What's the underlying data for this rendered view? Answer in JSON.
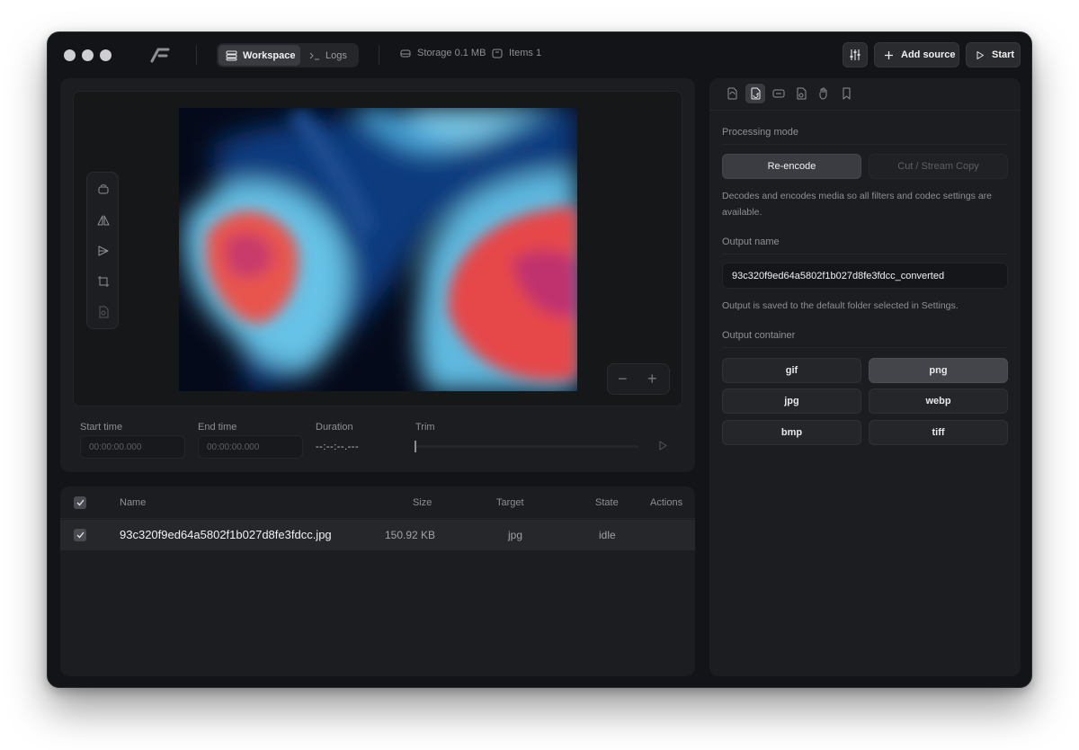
{
  "titlebar": {
    "tabs": [
      {
        "label": "Workspace",
        "active": true,
        "icon": "stack-icon"
      },
      {
        "label": "Logs",
        "active": false,
        "icon": "terminal-icon"
      }
    ],
    "storage": "Storage 0.1 MB",
    "items": "Items 1",
    "add_source": "Add source",
    "start": "Start"
  },
  "timing": {
    "start_label": "Start time",
    "start_placeholder": "00:00:00.000",
    "end_label": "End time",
    "end_placeholder": "00:00:00.000",
    "duration_label": "Duration",
    "duration_value": "--:--:--.---",
    "trim_label": "Trim"
  },
  "table": {
    "headers": {
      "name": "Name",
      "size": "Size",
      "target": "Target",
      "state": "State",
      "actions": "Actions"
    },
    "rows": [
      {
        "name": "93c320f9ed64a5802f1b027d8fe3fdcc.jpg",
        "size": "150.92 KB",
        "target": "jpg",
        "state": "idle",
        "checked": true
      }
    ]
  },
  "settings": {
    "processing_label": "Processing mode",
    "modes": [
      {
        "label": "Re-encode",
        "active": true
      },
      {
        "label": "Cut / Stream Copy",
        "active": false
      }
    ],
    "mode_help": "Decodes and encodes media so all filters and codec settings are available.",
    "output_name_label": "Output name",
    "output_name_value": "93c320f9ed64a5802f1b027d8fe3fdcc_converted",
    "output_help": "Output is saved to the default folder selected in Settings.",
    "container_label": "Output container",
    "containers": [
      {
        "label": "gif",
        "active": false
      },
      {
        "label": "png",
        "active": true
      },
      {
        "label": "jpg",
        "active": false
      },
      {
        "label": "webp",
        "active": false
      },
      {
        "label": "bmp",
        "active": false
      },
      {
        "label": "tiff",
        "active": false
      }
    ]
  },
  "colors": {
    "background": "#131417",
    "panel": "#1c1d20",
    "accent_active": "#3b3c41"
  }
}
